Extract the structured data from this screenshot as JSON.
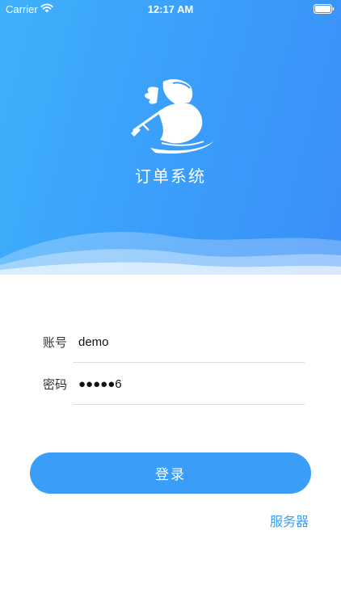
{
  "status_bar": {
    "carrier": "Carrier",
    "time": "12:17 AM",
    "wifi_icon": "wifi-icon",
    "battery_icon": "battery-icon"
  },
  "header": {
    "logo_icon": "ninja-logo-icon",
    "title": "订单系统",
    "gradient_start": "#3fb0fb",
    "gradient_end": "#3a8ff8"
  },
  "form": {
    "account": {
      "label": "账号",
      "value": "demo"
    },
    "password": {
      "label": "密码",
      "value": "●●●●●6"
    }
  },
  "actions": {
    "login_label": "登录",
    "server_label": "服务器",
    "accent_color": "#3a9ef9"
  }
}
